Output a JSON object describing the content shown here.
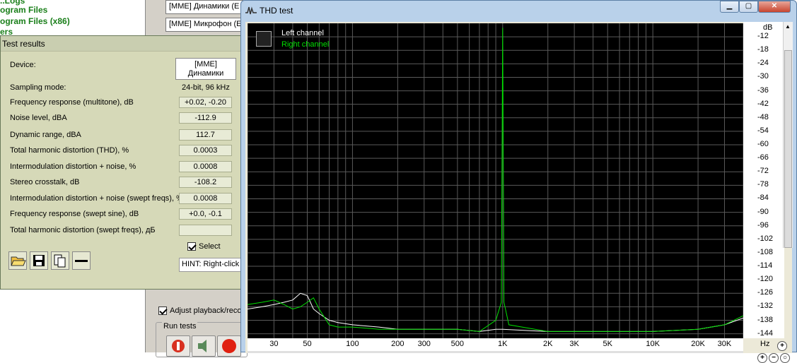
{
  "explorer": {
    "items": [
      "..Logs",
      "ogram Files",
      "ogram Files (x86)",
      "ers"
    ]
  },
  "rmaa": {
    "device_playback": "[MME] Динамики (E",
    "device_record": "[MME] Микрофон (E",
    "adjust_label": "Adjust playback/reco",
    "adjust_checked": true,
    "run_tests_label": "Run tests"
  },
  "results": {
    "title": "Test results",
    "device_label": "Device:",
    "device_value_line1": "[MME]",
    "device_value_line2": "Динамики",
    "sampling_label": "Sampling mode:",
    "sampling_value": "24-bit, 96 kHz",
    "rows": [
      {
        "label": "Frequency response (multitone), dB",
        "value": "+0.02, -0.20"
      },
      {
        "label": "Noise level, dBA",
        "value": "-112.9"
      },
      {
        "label": "Dynamic range, dBA",
        "value": "112.7"
      },
      {
        "label": "Total harmonic distortion (THD), %",
        "value": "0.0003"
      },
      {
        "label": "Intermodulation distortion + noise, %",
        "value": "0.0008"
      },
      {
        "label": "Stereo crosstalk, dB",
        "value": "-108.2"
      },
      {
        "label": "Intermodulation distortion + noise (swept freqs), %",
        "value": "0.0008"
      },
      {
        "label": "Frequency response (swept sine), dB",
        "value": "+0.0, -0.1"
      },
      {
        "label": "Total harmonic distortion (swept freqs), дБ",
        "value": ""
      }
    ],
    "select_label": "Select",
    "select_checked": true,
    "hint": "HINT: Right-click",
    "toolbar_icons": [
      "open-folder-icon",
      "save-icon",
      "copy-icon",
      "minus-icon"
    ]
  },
  "thd": {
    "title": "THD test",
    "window_buttons": [
      "minimize-icon",
      "maximize-icon",
      "close-icon"
    ],
    "legend": {
      "left": "Left channel",
      "right": "Right channel"
    },
    "colors": {
      "left": "#ffffff",
      "right": "#00e000",
      "grid": "#5a5a5a",
      "bg": "#000000"
    },
    "y_unit": "dB",
    "y_labels": [
      "-12",
      "-18",
      "-24",
      "-30",
      "-36",
      "-42",
      "-48",
      "-54",
      "-60",
      "-66",
      "-72",
      "-78",
      "-84",
      "-90",
      "-96",
      "-102",
      "-108",
      "-114",
      "-120",
      "-126",
      "-132",
      "-138",
      "-144"
    ],
    "x_labels": [
      "30",
      "50",
      "100",
      "200",
      "300",
      "500",
      "1K",
      "2K",
      "3K",
      "5K",
      "10K",
      "20K",
      "30K"
    ],
    "x_unit": "Hz"
  },
  "chart_data": {
    "type": "line",
    "title": "",
    "xlabel": "Hz",
    "ylabel": "dB",
    "x_scale": "log",
    "xlim": [
      20,
      40000
    ],
    "ylim": [
      -146,
      -6
    ],
    "grid": true,
    "legend_placement": "top-left",
    "series": [
      {
        "name": "Left channel",
        "x": [
          20,
          25,
          30,
          35,
          40,
          45,
          50,
          55,
          60,
          70,
          80,
          100,
          150,
          200,
          300,
          500,
          700,
          900,
          1000,
          2000,
          3000,
          5000,
          10000,
          20000,
          30000,
          40000
        ],
        "y": [
          -133,
          -132,
          -131,
          -130,
          -129,
          -126,
          -127,
          -133,
          -135,
          -138,
          -139,
          -140,
          -141,
          -142,
          -142,
          -142,
          -143,
          -142,
          -142,
          -143,
          -143,
          -143,
          -143,
          -142,
          -140,
          -137
        ]
      },
      {
        "name": "Right channel",
        "x": [
          20,
          25,
          30,
          35,
          40,
          45,
          50,
          55,
          60,
          70,
          80,
          100,
          150,
          200,
          300,
          500,
          700,
          900,
          980,
          1000,
          1020,
          1100,
          2000,
          3000,
          5000,
          10000,
          20000,
          30000,
          40000
        ],
        "y": [
          -131,
          -130,
          -129,
          -131,
          -133,
          -132,
          -130,
          -128,
          -133,
          -140,
          -141,
          -141,
          -142,
          -142,
          -142,
          -142,
          -143,
          -138,
          -130,
          -8,
          -130,
          -140,
          -143,
          -143,
          -143,
          -143,
          -142,
          -140,
          -136
        ]
      }
    ]
  }
}
